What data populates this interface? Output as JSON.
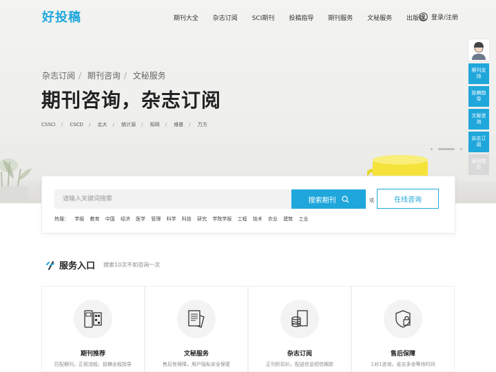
{
  "header": {
    "logo": "好投稿",
    "nav": [
      "期刊大全",
      "杂志订阅",
      "SCI期刊",
      "投稿指导",
      "期刊服务",
      "文秘服务",
      "出版社"
    ],
    "login": "登录/注册"
  },
  "hero": {
    "breadcrumb": [
      "杂志订阅",
      "期刊咨询",
      "文秘服务"
    ],
    "title": "期刊咨询，杂志订阅",
    "tags": [
      "CSSCI",
      "CSCD",
      "北大",
      "统计源",
      "知网",
      "维普",
      "万方"
    ]
  },
  "search": {
    "placeholder": "请输入关键词搜索",
    "button": "搜索期刊",
    "or": "或",
    "consult": "在线咨询",
    "hot_label": "热搜：",
    "hot": [
      "学报",
      "教育",
      "中国",
      "经济",
      "医学",
      "管理",
      "科学",
      "科技",
      "研究",
      "学院学报",
      "工程",
      "技术",
      "农业",
      "建筑",
      "工业"
    ]
  },
  "services": {
    "title": "服务入口",
    "subtitle": "搜索10次不如咨询一次",
    "cards": [
      {
        "title": "期刊推荐",
        "desc": "匹配期刊，正规流程，投稿全程指导",
        "icon": "scanner-icon"
      },
      {
        "title": "文秘服务",
        "desc": "售后有保障，用户隐私安全保密",
        "icon": "document-icon"
      },
      {
        "title": "杂志订阅",
        "desc": "正刊折扣价，配送信息短信跟踪",
        "icon": "coins-icon"
      },
      {
        "title": "售后保障",
        "desc": "1对1咨询，省去多余等待时间",
        "icon": "shield-lock-icon"
      }
    ]
  },
  "sidebar": {
    "buttons": [
      "期刊支持",
      "投稿指导",
      "文秘咨询",
      "杂志订阅"
    ],
    "top": "返回首页"
  },
  "colors": {
    "accent": "#1fa7dc"
  }
}
